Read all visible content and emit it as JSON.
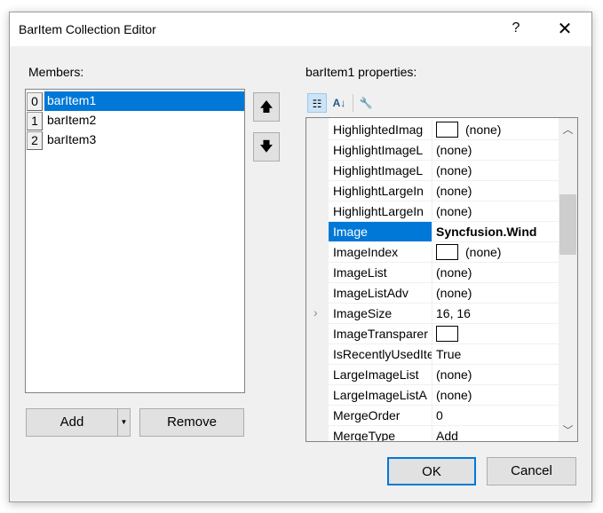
{
  "window": {
    "title": "BarItem Collection Editor",
    "help": "?",
    "close": "✕"
  },
  "members": {
    "label": "Members:",
    "items": [
      {
        "index": "0",
        "name": "barItem1",
        "selected": true
      },
      {
        "index": "1",
        "name": "barItem2"
      },
      {
        "index": "2",
        "name": "barItem3"
      }
    ],
    "up_icon": "arrow-up-icon",
    "down_icon": "arrow-down-icon",
    "add": "Add",
    "remove": "Remove"
  },
  "properties": {
    "label": "barItem1 properties:",
    "rows": [
      {
        "name": "HighlightedImag",
        "value": "(none)",
        "swatch": true
      },
      {
        "name": "HighlightImageL",
        "value": "(none)"
      },
      {
        "name": "HighlightImageL",
        "value": "(none)"
      },
      {
        "name": "HighlightLargeIn",
        "value": "(none)"
      },
      {
        "name": "HighlightLargeIn",
        "value": "(none)"
      },
      {
        "name": "Image",
        "value": "Syncfusion.Wind",
        "selected": true
      },
      {
        "name": "ImageIndex",
        "value": "(none)",
        "swatch": true
      },
      {
        "name": "ImageList",
        "value": "(none)"
      },
      {
        "name": "ImageListAdv",
        "value": "(none)"
      },
      {
        "name": "ImageSize",
        "value": "16, 16",
        "expandable": true
      },
      {
        "name": "ImageTransparer",
        "value": "",
        "swatch": true
      },
      {
        "name": "IsRecentlyUsedIte",
        "value": "True"
      },
      {
        "name": "LargeImageList",
        "value": "(none)"
      },
      {
        "name": "LargeImageListA",
        "value": "(none)"
      },
      {
        "name": "MergeOrder",
        "value": "0"
      },
      {
        "name": "MergeType",
        "value": "Add"
      }
    ]
  },
  "footer": {
    "ok": "OK",
    "cancel": "Cancel"
  },
  "colors": {
    "accent": "#0078d7"
  }
}
